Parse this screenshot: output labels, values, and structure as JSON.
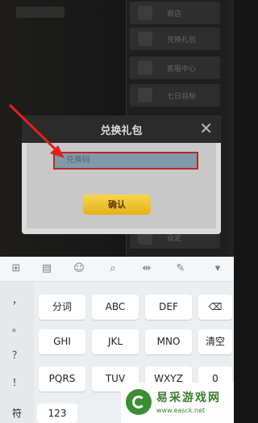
{
  "background": {
    "side_menu": [
      "商店",
      "兑换礼包",
      "客服中心",
      "七日目标"
    ],
    "bottom_item": "设定"
  },
  "dialog": {
    "title": "兑换礼包",
    "close": "✕",
    "input_placeholder": "兑换码",
    "confirm_label": "确认"
  },
  "keyboard": {
    "toolbar": [
      "⊞",
      "▤",
      "☺",
      "⌕",
      "⇹",
      "✎",
      "▾"
    ],
    "left_column": [
      "，",
      "。",
      "？",
      "！"
    ],
    "keys": [
      [
        "分词",
        "ABC",
        "DEF",
        "⌫"
      ],
      [
        "GHI",
        "JKL",
        "MNO",
        "清空"
      ],
      [
        "PQRS",
        "TUV",
        "WXYZ",
        "0"
      ]
    ],
    "symbol_key": "符",
    "num_key": "123"
  },
  "watermark": {
    "title": "易采游戏网",
    "url": "www.easck.net"
  }
}
